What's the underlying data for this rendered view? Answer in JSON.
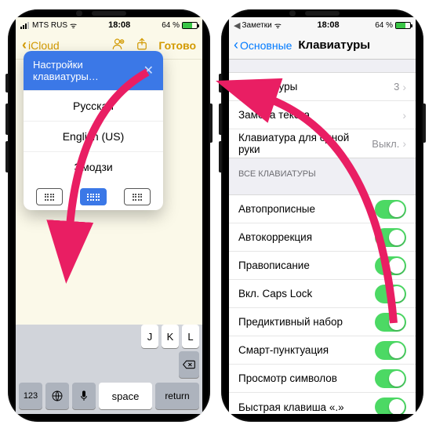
{
  "left": {
    "status": {
      "carrier": "MTS RUS",
      "wifi": "ᯤ",
      "time": "18:08",
      "battery_pct": "64 %",
      "battery_icon": "▭"
    },
    "nav": {
      "back": "iCloud",
      "done": "Готово"
    },
    "keyboard_menu": {
      "header": "Настройки клавиатуры…",
      "items": [
        "Русская",
        "English (US)",
        "Эмодзи"
      ]
    },
    "keys_top": [
      "J",
      "K",
      "L"
    ],
    "bottom": {
      "k123": "123",
      "space": "space",
      "ret": "return"
    }
  },
  "right": {
    "status": {
      "app": "Заметки",
      "wifi": "ᯤ",
      "time": "18:08",
      "battery_pct": "64 %"
    },
    "nav": {
      "back": "Основные",
      "title": "Клавиатуры"
    },
    "group1": [
      {
        "label": "Клавиатуры",
        "value": "3"
      },
      {
        "label": "Замена текста"
      },
      {
        "label": "Клавиатура для одной руки",
        "value": "Выкл."
      }
    ],
    "group2_header": "ВСЕ КЛАВИАТУРЫ",
    "group2": [
      {
        "label": "Автопрописные"
      },
      {
        "label": "Автокоррекция"
      },
      {
        "label": "Правописание"
      },
      {
        "label": "Вкл. Caps Lock"
      },
      {
        "label": "Предиктивный набор"
      },
      {
        "label": "Смарт-пунктуация"
      },
      {
        "label": "Просмотр символов"
      },
      {
        "label": "Быстрая клавиша «.»"
      }
    ]
  }
}
